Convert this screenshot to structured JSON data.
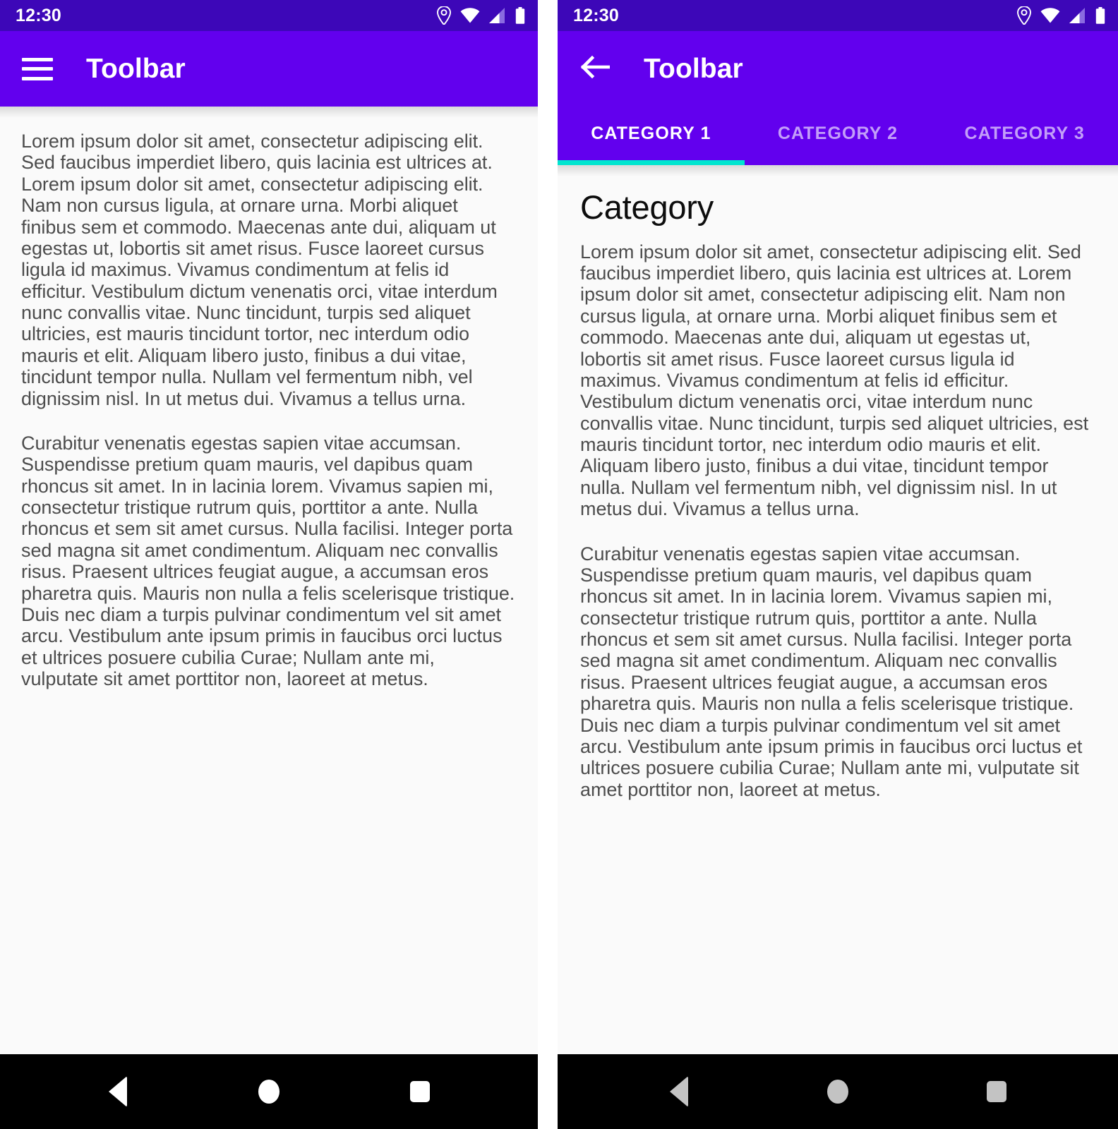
{
  "status_bar": {
    "time": "12:30",
    "icons": [
      "location-pin-icon",
      "wifi-icon",
      "cellular-signal-icon",
      "battery-icon"
    ]
  },
  "colors": {
    "status_bar": "#3d07b8",
    "toolbar": "#6200ee",
    "tab_indicator": "#00e5cf",
    "content_background": "#fafafa",
    "body_text": "#4c4c4c",
    "heading_text": "#0d0d0d",
    "nav_bar": "#000000",
    "nav_icon_left": "#ffffff",
    "nav_icon_right": "#c3c3c3"
  },
  "left_screen": {
    "toolbar": {
      "menu_icon": "hamburger-menu-icon",
      "title": "Toolbar"
    },
    "paragraphs": [
      "Lorem ipsum dolor sit amet, consectetur adipiscing elit. Sed faucibus imperdiet libero, quis lacinia est ultrices at. Lorem ipsum dolor sit amet, consectetur adipiscing elit. Nam non cursus ligula, at ornare urna. Morbi aliquet finibus sem et commodo. Maecenas ante dui, aliquam ut egestas ut, lobortis sit amet risus. Fusce laoreet cursus ligula id maximus. Vivamus condimentum at felis id efficitur. Vestibulum dictum venenatis orci, vitae interdum nunc convallis vitae. Nunc tincidunt, turpis sed aliquet ultricies, est mauris tincidunt tortor, nec interdum odio mauris et elit. Aliquam libero justo, finibus a dui vitae, tincidunt tempor nulla. Nullam vel fermentum nibh, vel dignissim nisl. In ut metus dui. Vivamus a tellus urna.",
      "Curabitur venenatis egestas sapien vitae accumsan. Suspendisse pretium quam mauris, vel dapibus quam rhoncus sit amet. In in lacinia lorem. Vivamus sapien mi, consectetur tristique rutrum quis, porttitor a ante. Nulla rhoncus et sem sit amet cursus. Nulla facilisi. Integer porta sed magna sit amet condimentum. Aliquam nec convallis risus. Praesent ultrices feugiat augue, a accumsan eros pharetra quis. Mauris non nulla a felis scelerisque tristique. Duis nec diam a turpis pulvinar condimentum vel sit amet arcu. Vestibulum ante ipsum primis in faucibus orci luctus et ultrices posuere cubilia Curae; Nullam ante mi, vulputate sit amet porttitor non, laoreet at metus."
    ],
    "nav_bar": {
      "back": "back-navigation-button",
      "home": "home-navigation-button",
      "recents": "recents-navigation-button"
    }
  },
  "right_screen": {
    "toolbar": {
      "back_icon": "back-arrow-icon",
      "title": "Toolbar"
    },
    "tabs": [
      {
        "label": "CATEGORY 1",
        "active": true
      },
      {
        "label": "CATEGORY 2",
        "active": false
      },
      {
        "label": "CATEGORY 3",
        "active": false
      }
    ],
    "heading": "Category",
    "paragraphs": [
      "Lorem ipsum dolor sit amet, consectetur adipiscing elit. Sed faucibus imperdiet libero, quis lacinia est ultrices at. Lorem ipsum dolor sit amet, consectetur adipiscing elit. Nam non cursus ligula, at ornare urna. Morbi aliquet finibus sem et commodo. Maecenas ante dui, aliquam ut egestas ut, lobortis sit amet risus. Fusce laoreet cursus ligula id maximus. Vivamus condimentum at felis id efficitur. Vestibulum dictum venenatis orci, vitae interdum nunc convallis vitae. Nunc tincidunt, turpis sed aliquet ultricies, est mauris tincidunt tortor, nec interdum odio mauris et elit. Aliquam libero justo, finibus a dui vitae, tincidunt tempor nulla. Nullam vel fermentum nibh, vel dignissim nisl. In ut metus dui. Vivamus a tellus urna.",
      "Curabitur venenatis egestas sapien vitae accumsan. Suspendisse pretium quam mauris, vel dapibus quam rhoncus sit amet. In in lacinia lorem. Vivamus sapien mi, consectetur tristique rutrum quis, porttitor a ante. Nulla rhoncus et sem sit amet cursus. Nulla facilisi. Integer porta sed magna sit amet condimentum. Aliquam nec convallis risus. Praesent ultrices feugiat augue, a accumsan eros pharetra quis. Mauris non nulla a felis scelerisque tristique. Duis nec diam a turpis pulvinar condimentum vel sit amet arcu. Vestibulum ante ipsum primis in faucibus orci luctus et ultrices posuere cubilia Curae; Nullam ante mi, vulputate sit amet porttitor non, laoreet at metus."
    ],
    "nav_bar": {
      "back": "back-navigation-button",
      "home": "home-navigation-button",
      "recents": "recents-navigation-button"
    }
  }
}
